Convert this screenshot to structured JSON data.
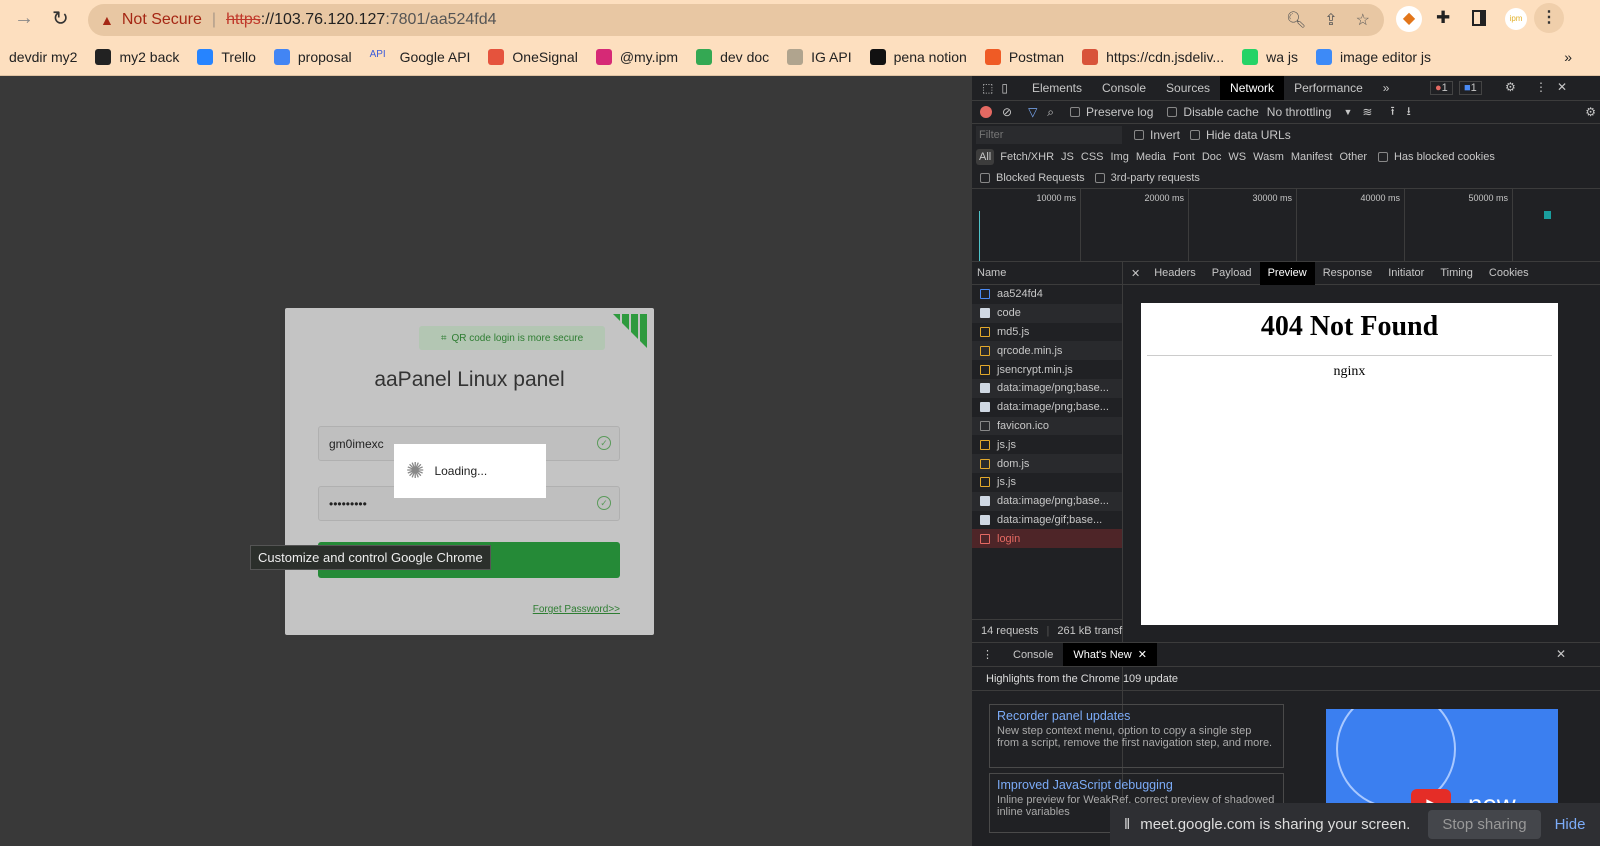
{
  "browser": {
    "security_label": "Not Secure",
    "url_scheme": "https",
    "url_rest": "://103.76.120.127",
    "url_port_path": ":7801/aa524fd4",
    "bookmarks": [
      "devdir my2",
      "my2 back",
      "Trello",
      "proposal",
      "Google API",
      "OneSignal",
      "@my.ipm",
      "dev doc",
      "IG API",
      "pena notion",
      "Postman",
      "https://cdn.jsdeliv...",
      "wa js",
      "image editor js"
    ],
    "bookmark_colors": [
      "",
      "#222",
      "#2684ff",
      "#4285f4",
      "#3b5bdb",
      "#e5533d",
      "#d62976",
      "#34a853",
      "#b0a48e",
      "#111",
      "#ef5b25",
      "#d8533a",
      "#25d366",
      "#3d8af7"
    ],
    "api_badge": "API",
    "more_bookmarks": "»",
    "tooltip": "Customize and control Google Chrome"
  },
  "login": {
    "qr_hint": "QR code login is more secure",
    "title": "aaPanel Linux panel",
    "username": "gm0imexc",
    "password": "•••••••••",
    "loading": "Loading...",
    "forgot": "Forget Password>>",
    "accent": "#20a53a"
  },
  "devtools": {
    "tabs": [
      "Elements",
      "Console",
      "Sources",
      "Network",
      "Performance",
      "»"
    ],
    "errors": "1",
    "messages": "1",
    "toolbar": {
      "preserve_log": "Preserve log",
      "disable_cache": "Disable cache",
      "throttling": "No throttling"
    },
    "filter_placeholder": "Filter",
    "invert": "Invert",
    "hide_data_urls": "Hide data URLs",
    "types": [
      "All",
      "Fetch/XHR",
      "JS",
      "CSS",
      "Img",
      "Media",
      "Font",
      "Doc",
      "WS",
      "Wasm",
      "Manifest",
      "Other"
    ],
    "has_blocked_cookies": "Has blocked cookies",
    "blocked_requests": "Blocked Requests",
    "third_party": "3rd-party requests",
    "timeline_ticks": [
      "10000 ms",
      "20000 ms",
      "30000 ms",
      "40000 ms",
      "50000 ms"
    ],
    "name_header": "Name",
    "requests": [
      {
        "name": "aa524fd4",
        "type": "doc"
      },
      {
        "name": "code",
        "type": "img"
      },
      {
        "name": "md5.js",
        "type": "js"
      },
      {
        "name": "qrcode.min.js",
        "type": "js"
      },
      {
        "name": "jsencrypt.min.js",
        "type": "js"
      },
      {
        "name": "data:image/png;base...",
        "type": "img"
      },
      {
        "name": "data:image/png;base...",
        "type": "img"
      },
      {
        "name": "favicon.ico",
        "type": "other"
      },
      {
        "name": "js.js",
        "type": "js"
      },
      {
        "name": "dom.js",
        "type": "js"
      },
      {
        "name": "js.js",
        "type": "js"
      },
      {
        "name": "data:image/png;base...",
        "type": "img"
      },
      {
        "name": "data:image/gif;base...",
        "type": "img"
      },
      {
        "name": "login",
        "type": "error"
      }
    ],
    "detail_tabs": [
      "Headers",
      "Payload",
      "Preview",
      "Response",
      "Initiator",
      "Timing",
      "Cookies"
    ],
    "preview": {
      "heading": "404 Not Found",
      "server": "nginx"
    },
    "summary": {
      "requests": "14 requests",
      "transferred": "261 kB transf"
    },
    "drawer_tabs": [
      "Console",
      "What's New"
    ],
    "highlights": "Highlights from the Chrome 109 update",
    "cards": [
      {
        "title": "Recorder panel updates",
        "body": "New step context menu, option to copy a single step from a script, remove the first navigation step, and more."
      },
      {
        "title": "Improved JavaScript debugging",
        "body": "Inline preview for WeakRef, correct preview of shadowed inline variables"
      }
    ],
    "video_word": "new"
  },
  "share_bar": {
    "text": "meet.google.com is sharing your screen.",
    "stop": "Stop sharing",
    "hide": "Hide"
  }
}
